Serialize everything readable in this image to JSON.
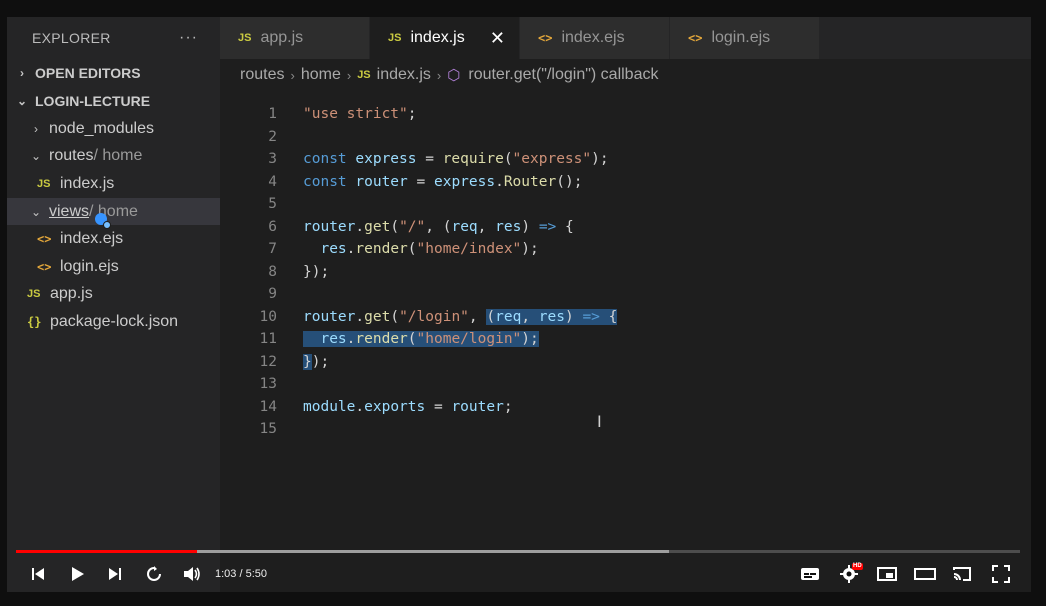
{
  "sidebar": {
    "title": "EXPLORER",
    "more_icon": "ellipsis-icon",
    "open_editors": "OPEN EDITORS",
    "project": "LOGIN-LECTURE",
    "items": [
      {
        "label": "node_modules"
      },
      {
        "label": "routes",
        "suffix": " / home"
      },
      {
        "label": "index.js",
        "icon": "JS"
      },
      {
        "label": "views",
        "suffix": " / home"
      },
      {
        "label": "index.ejs",
        "icon": "<>"
      },
      {
        "label": "login.ejs",
        "icon": "<>"
      },
      {
        "label": "app.js",
        "icon": "JS"
      },
      {
        "label": "package-lock.json",
        "icon": "{}"
      }
    ]
  },
  "tabs": [
    {
      "label": "app.js",
      "icon": "JS"
    },
    {
      "label": "index.js",
      "icon": "JS",
      "active": true
    },
    {
      "label": "index.ejs",
      "icon": "<>"
    },
    {
      "label": "login.ejs",
      "icon": "<>"
    }
  ],
  "breadcrumb": {
    "parts": [
      "routes",
      "home",
      "index.js",
      "router.get(\"/login\") callback"
    ],
    "js_icon": "JS"
  },
  "editor": {
    "line_numbers": [
      "1",
      "2",
      "3",
      "4",
      "5",
      "6",
      "7",
      "8",
      "9",
      "10",
      "11",
      "12",
      "13",
      "14",
      "15"
    ],
    "lines": [
      "\"use strict\";",
      "",
      "const express = require(\"express\");",
      "const router = express.Router();",
      "",
      "router.get(\"/\", (req, res) => {",
      "  res.render(\"home/index\");",
      "});",
      "",
      "router.get(\"/login\", (req, res) => {",
      "  res.render(\"home/login\");",
      "});",
      "",
      "module.exports = router;",
      ""
    ]
  },
  "player": {
    "time": "1:03 / 5:50",
    "played_fraction": 0.18,
    "buffered_fraction": 0.65,
    "hd_badge": "HD",
    "colors": {
      "progress": "#ff0000"
    }
  }
}
